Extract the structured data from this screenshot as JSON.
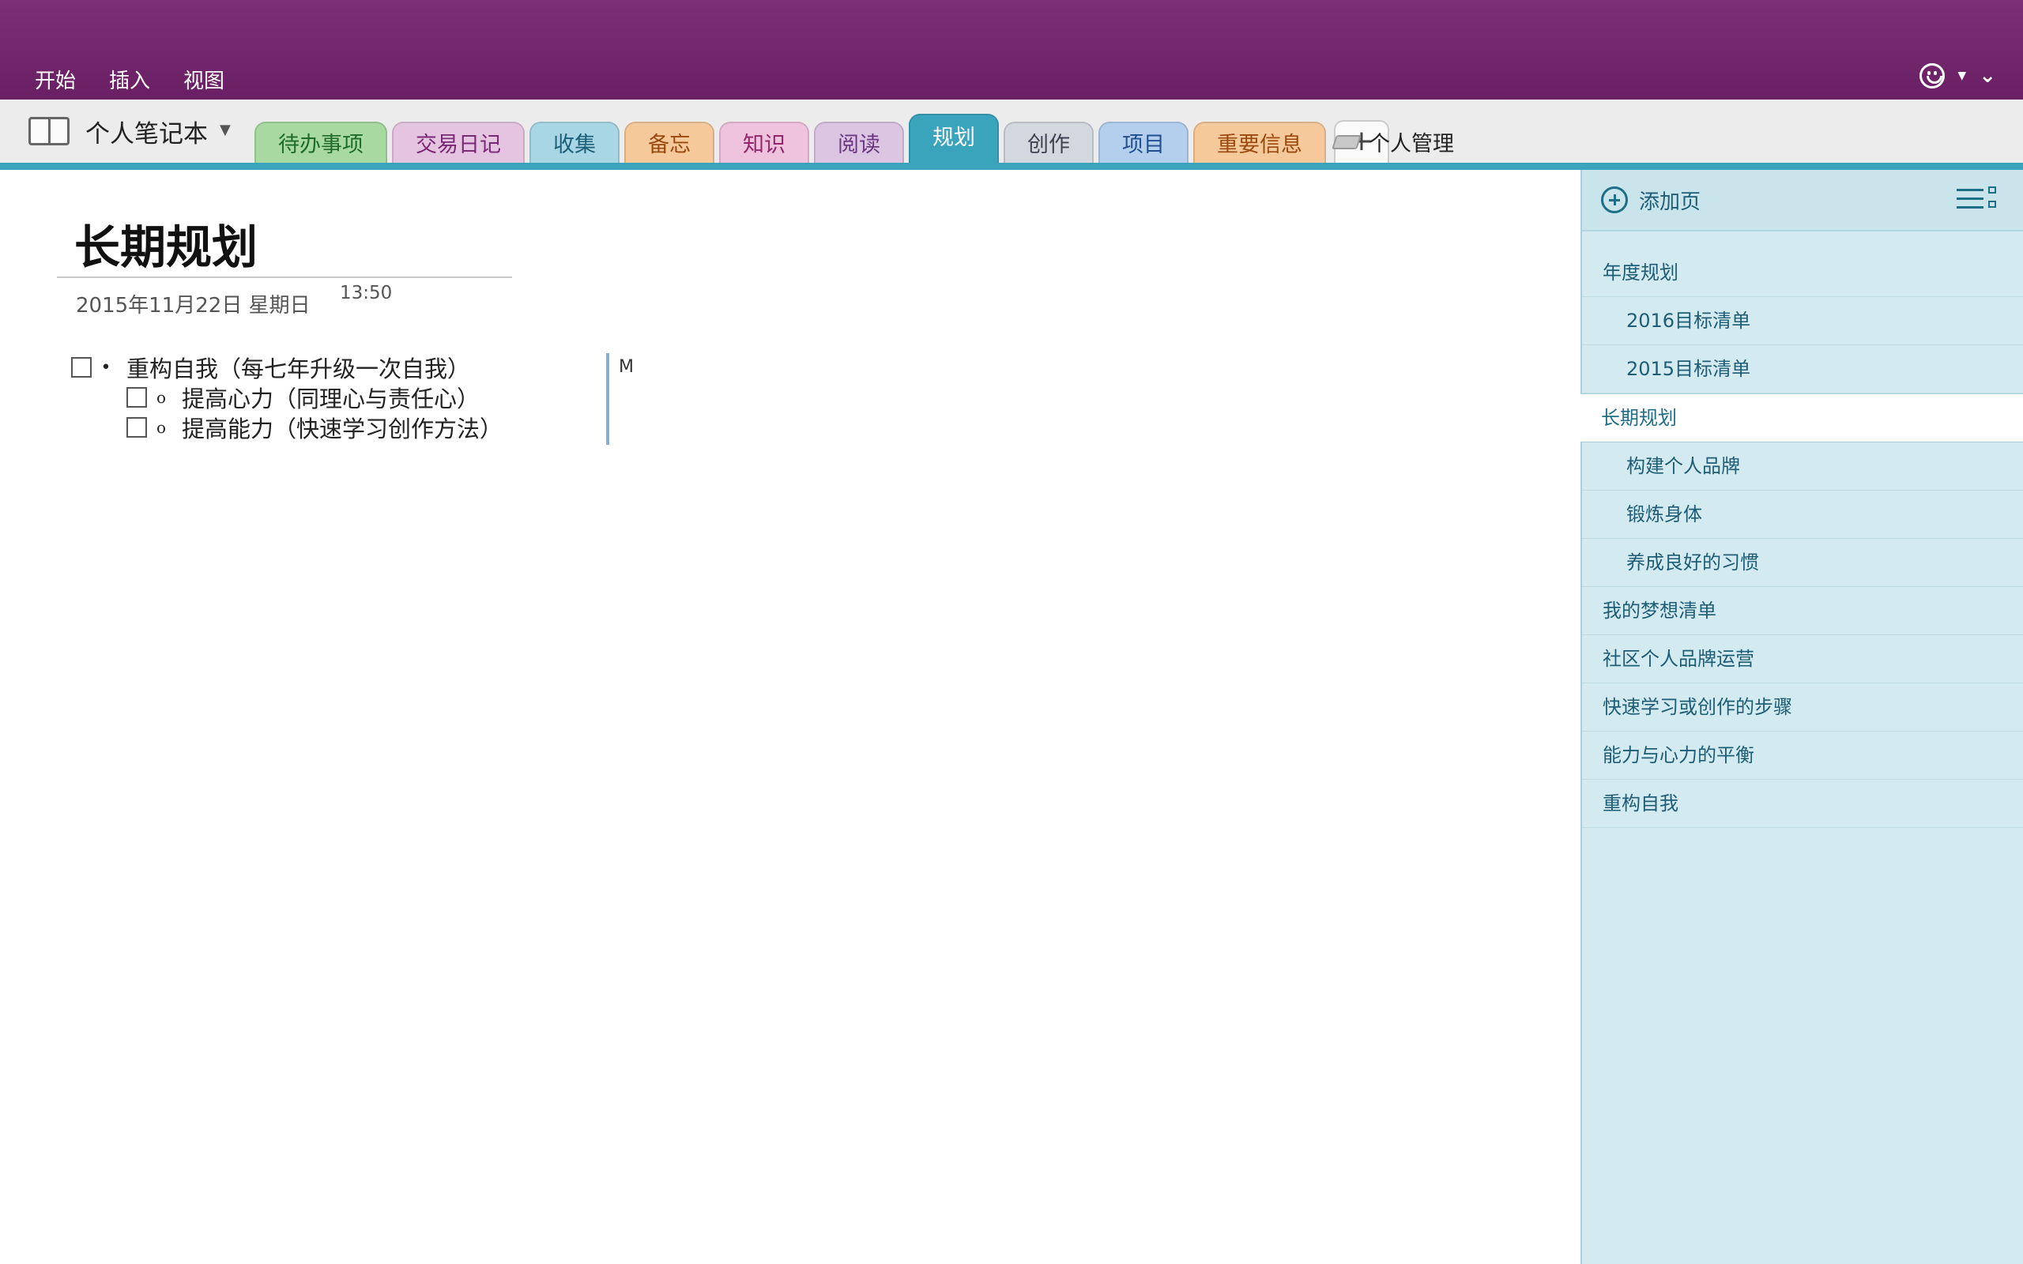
{
  "menu": {
    "items": [
      "开始",
      "插入",
      "视图"
    ]
  },
  "notebook": {
    "title": "个人笔记本"
  },
  "tabs": [
    {
      "label": "待办事项",
      "color": "#a8d9a1",
      "text": "#1f6b28"
    },
    {
      "label": "交易日记",
      "color": "#e5c4e2",
      "text": "#7a2a75"
    },
    {
      "label": "收集",
      "color": "#a9d6e4",
      "text": "#1c5f78"
    },
    {
      "label": "备忘",
      "color": "#f6c99a",
      "text": "#9a4a10"
    },
    {
      "label": "知识",
      "color": "#efc3de",
      "text": "#93266b"
    },
    {
      "label": "阅读",
      "color": "#dcc4e3",
      "text": "#6a3880"
    },
    {
      "label": "规划",
      "color": "#3aa4bd",
      "text": "#ffffff",
      "active": true
    },
    {
      "label": "创作",
      "color": "#d3d7de",
      "text": "#3d4350"
    },
    {
      "label": "项目",
      "color": "#b4cfee",
      "text": "#1f4f8f"
    },
    {
      "label": "重要信息",
      "color": "#f6c99a",
      "text": "#9a4a10"
    }
  ],
  "tab_add": {
    "label": "+"
  },
  "section_group": {
    "label": "个人管理"
  },
  "page": {
    "title": "长期规划",
    "date": "2015年11月22日 星期日",
    "time": "13:50",
    "side_note": "M",
    "items": [
      {
        "text": "重构自我（每七年升级一次自我）",
        "level": 1
      },
      {
        "text": "提高心力（同理心与责任心）",
        "level": 2
      },
      {
        "text": "提高能力（快速学习创作方法）",
        "level": 2
      }
    ]
  },
  "pages_pane": {
    "add_label": "添加页",
    "pages": [
      {
        "label": "年度规划",
        "sub": false
      },
      {
        "label": "2016目标清单",
        "sub": true
      },
      {
        "label": "2015目标清单",
        "sub": true
      },
      {
        "label": "长期规划",
        "sub": false,
        "active": true
      },
      {
        "label": "构建个人品牌",
        "sub": true
      },
      {
        "label": "锻炼身体",
        "sub": true
      },
      {
        "label": "养成良好的习惯",
        "sub": true
      },
      {
        "label": "我的梦想清单",
        "sub": false
      },
      {
        "label": "社区个人品牌运营",
        "sub": false
      },
      {
        "label": "快速学习或创作的步骤",
        "sub": false
      },
      {
        "label": "能力与心力的平衡",
        "sub": false
      },
      {
        "label": "重构自我",
        "sub": false
      }
    ]
  }
}
